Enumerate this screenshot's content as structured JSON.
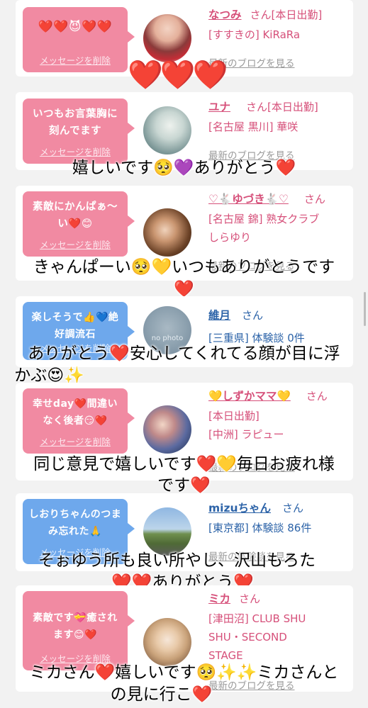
{
  "cards": [
    {
      "bubble_color": "pink",
      "message": "❤️❤️😈❤️❤️",
      "delete_label": "メッセージを削除",
      "name": "なつみ",
      "san": "さん[本日出勤]",
      "detail1": "[すすきの] KiRaRa",
      "detail2": "",
      "link": "最新のブログを見る"
    },
    {
      "bubble_color": "pink",
      "message": "いつもお言葉胸に刻んでます",
      "delete_label": "メッセージを削除",
      "name": "ユナ",
      "san": "さん[本日出勤]",
      "detail1": "[名古屋 黒川] 華咲",
      "detail2": "",
      "link": "最新のブログを見る"
    },
    {
      "bubble_color": "pink",
      "message": "素敵にかんぱぁ〜い❤️😊",
      "delete_label": "メッセージを削除",
      "name": "♡🐇ゆづき🐇♡",
      "san": "さん",
      "detail1": "[名古屋 錦] 熟女クラブ",
      "detail2": "しらゆり",
      "link": "最新のブログを見る"
    },
    {
      "bubble_color": "blue",
      "message": "楽しそうで👍💙絶好調流石",
      "delete_label": "メッセージを削除",
      "name": "維月",
      "san": "さん",
      "detail1": "[三重県] 体験談 0件",
      "detail2": "",
      "link": "",
      "avatar_text": "no photo"
    },
    {
      "bubble_color": "pink",
      "message": "幸せday❤️間違いなく後者😏❤️",
      "delete_label": "メッセージを削除",
      "name": "💛しずかママ💛",
      "san": "さん",
      "detail1": "[本日出勤]",
      "detail2": "[中洲] ラピュー",
      "link": "最新のブログを見る"
    },
    {
      "bubble_color": "blue",
      "message": "しおりちゃんのつまみ忘れた🙏",
      "delete_label": "メッセージを削除",
      "name": "mizuちゃん",
      "san": "さん",
      "detail1": "[東京都] 体験談 86件",
      "detail2": "",
      "link": "最新の体験談を見る"
    },
    {
      "bubble_color": "pink",
      "message": "素敵です💝癒されます😊❤️",
      "delete_label": "メッセージを削除",
      "name": "ミカ",
      "san": "さん",
      "detail1": "[津田沼] CLUB SHU",
      "detail2": "SHU・SECOND",
      "detail3": "STAGE",
      "link": "最新のブログを見る"
    }
  ],
  "overlay": {
    "big_hearts": "❤️❤️❤️",
    "caption1": "嬉しいです🥺💜ありがとう❤️",
    "caption2a": "きゃんぱーい🥺💛いつもありがとうです",
    "caption2b": "❤️",
    "caption3a": "ありがとう❤️安心してくれてる顔が目に浮",
    "caption3b": "かぶ😍✨",
    "caption4a": "同じ意見で嬉しいです❤️💛毎日お疲れ様",
    "caption4b": "です❤️",
    "caption5a": "そぉゆう所も良い所やし、沢山もろた",
    "caption5b": "❤️❤️ありがとう❤️",
    "caption6a": "ミカさん❤️嬉しいです🥺✨✨ミカさんと",
    "caption6b": "の見に行こ❤️"
  }
}
